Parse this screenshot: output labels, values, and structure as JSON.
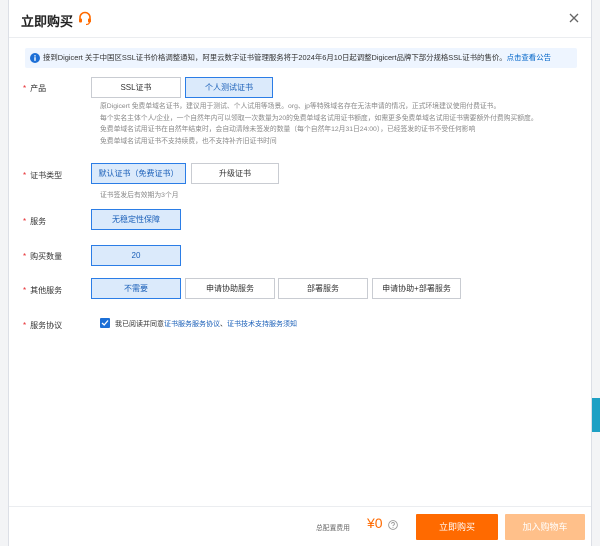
{
  "dialog": {
    "title": "立即购买",
    "close_icon": "close-icon",
    "headset_icon": "headset-icon"
  },
  "notice": {
    "text": "接到Digicert 关于中国区SSL证书价格调整通知，阿里云数字证书管理服务将于2024年6月10日起调整Digicert品牌下部分规格SSL证书的售价。",
    "link": "点击查看公告",
    "icon": "info-icon"
  },
  "product": {
    "label": "产品",
    "options": [
      "SSL证书",
      "个人测试证书"
    ],
    "selected": 1,
    "help": [
      "原Digicert 免费单域名证书，建议用于测试、个人试用等场景。org、jp等特殊域名存在无法申请的情况，正式环境建议使用付费证书。",
      "每个实名主体个人/企业，一个自然年内可以领取一次数量为20的免费单域名试用证书额度，如需更多免费单域名试用证书需要额外付费购买额度。",
      "免费单域名试用证书在自然年结束时，会自动清除未签发的数量（每个自然年12月31日24:00），已经签发的证书不受任何影响",
      "免费单域名试用证书不支持续费，也不支持补齐旧证书时间"
    ]
  },
  "cert_type": {
    "label": "证书类型",
    "options": [
      "默认证书（免费证书）",
      "升级证书"
    ],
    "selected": 0,
    "help": "证书签发后有效期为3个月"
  },
  "service": {
    "label": "服务",
    "options": [
      "无稳定性保障"
    ],
    "selected": 0
  },
  "quantity": {
    "label": "购买数量",
    "value": "20"
  },
  "other_services": {
    "label": "其他服务",
    "options": [
      "不需要",
      "申请协助服务",
      "部署服务",
      "申请协助+部署服务"
    ],
    "selected": 0
  },
  "agreement": {
    "label": "服务协议",
    "checked": true,
    "prefix": "我已阅读并同意",
    "link1": "证书服务服务协议",
    "sep": "、",
    "link2": "证书技术支持服务须知"
  },
  "footer": {
    "fee_label": "总配置费用",
    "fee_value": "¥0",
    "buy_label": "立即购买",
    "cart_label": "加入购物车"
  },
  "colors": {
    "accent": "#2b7de6",
    "selected_bg": "#dbeafb",
    "price": "#ff6a00",
    "buy": "#ff6a00",
    "cart": "#ffc08a",
    "required": "#e6262b"
  }
}
